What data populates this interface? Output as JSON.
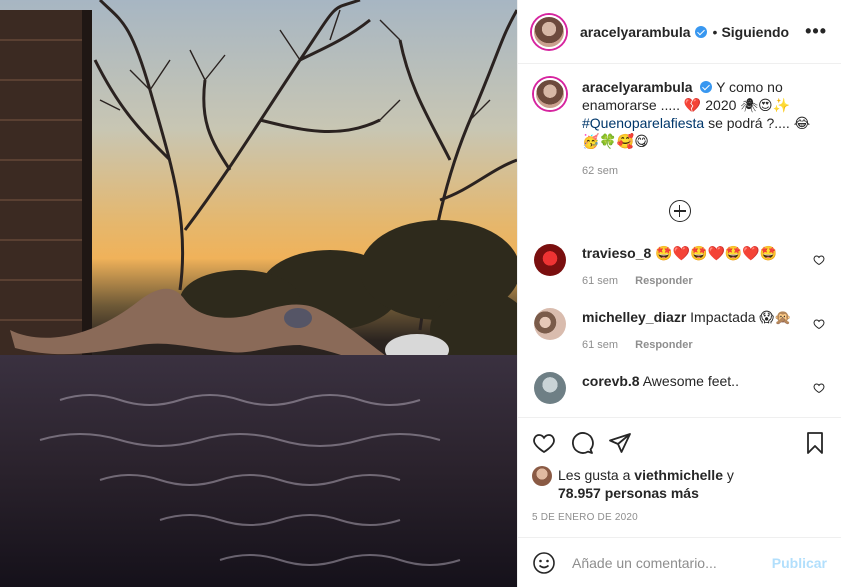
{
  "post": {
    "username": "aracelyarambula",
    "follow_label": "Siguiendo",
    "dot": "•",
    "more": "•••"
  },
  "caption": {
    "username": "aracelyarambula",
    "text_line1": "Y como no",
    "text_line2": "enamorarse ..... 💔 2020 🕷😍✨",
    "hashtag": "#Quenoparelafiesta",
    "text_line3": " se podrá ?.... 😂",
    "text_line4": "🥳🍀🥰😋",
    "time": "62 sem"
  },
  "comments": [
    {
      "user": "travieso_8",
      "text": "🤩❤️🤩❤️🤩❤️🤩",
      "time": "61 sem",
      "reply": "Responder",
      "avatar_color": "#a01818"
    },
    {
      "user": "michelley_diazr",
      "text": "Impactada 😱🙊",
      "time": "61 sem",
      "reply": "Responder",
      "avatar_color": "#c9a899"
    },
    {
      "user": "corevb.8",
      "text": "Awesome feet..",
      "time": "",
      "reply": "",
      "avatar_color": "#8fa1a7"
    }
  ],
  "likes": {
    "prefix": "Les gusta a ",
    "user": "viethmichelle",
    "suffix": " y",
    "count": "78.957 personas más"
  },
  "date": "5 DE ENERO DE 2020",
  "add_comment": {
    "placeholder": "Añade un comentario...",
    "publish": "Publicar"
  },
  "colors": {
    "accent": "#3897f0",
    "publish_disabled": "#b2dffc",
    "link": "#00376b"
  }
}
